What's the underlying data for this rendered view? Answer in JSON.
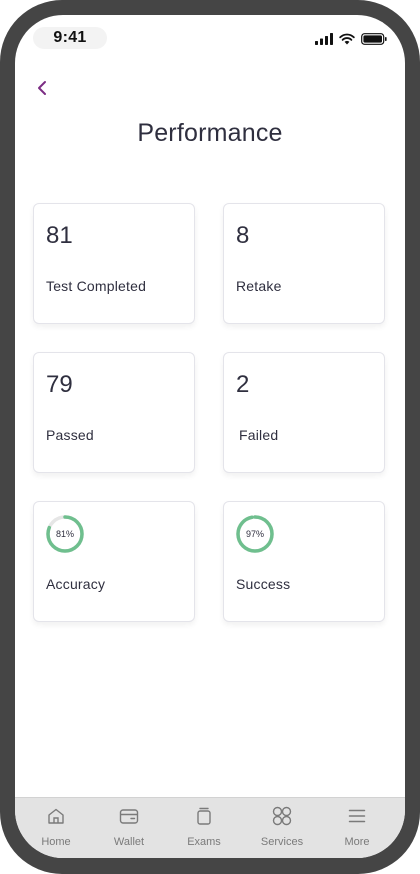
{
  "status": {
    "time": "9:41"
  },
  "header": {
    "title": "Performance"
  },
  "stats": [
    {
      "value": "81",
      "label": "Test Completed"
    },
    {
      "value": "8",
      "label": "Retake"
    },
    {
      "value": "79",
      "label": "Passed"
    },
    {
      "value": "2",
      "label": "Failed"
    }
  ],
  "progress": [
    {
      "percent": 81,
      "percent_text": "81%",
      "label": "Accuracy"
    },
    {
      "percent": 97,
      "percent_text": "97%",
      "label": "Success"
    }
  ],
  "colors": {
    "accent": "#7b2d83",
    "ring": "#6fbf8e",
    "ring_track": "#e6e6e6"
  },
  "tabs": [
    {
      "label": "Home",
      "icon": "home-icon"
    },
    {
      "label": "Wallet",
      "icon": "wallet-icon"
    },
    {
      "label": "Exams",
      "icon": "exams-icon"
    },
    {
      "label": "Services",
      "icon": "services-icon"
    },
    {
      "label": "More",
      "icon": "menu-icon"
    }
  ]
}
